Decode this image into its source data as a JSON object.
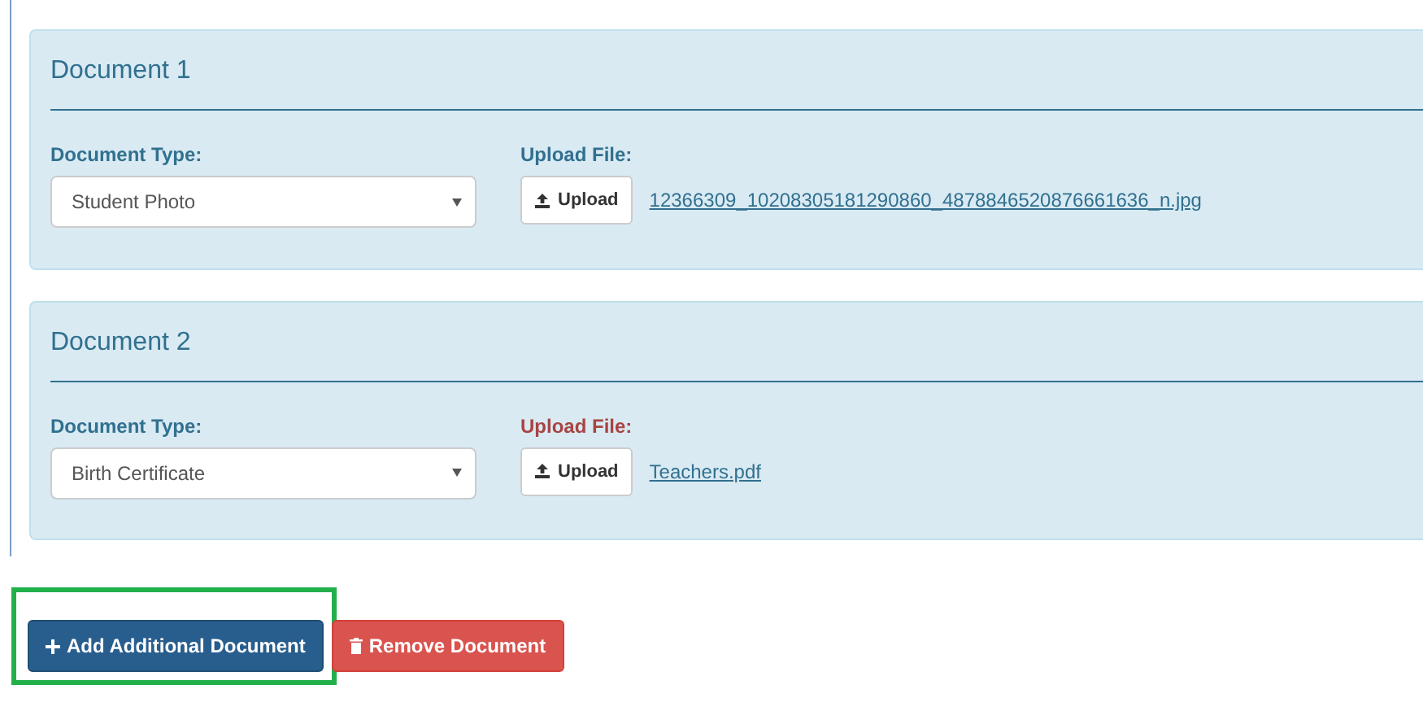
{
  "documents": [
    {
      "title": "Document 1",
      "type_label": "Document Type:",
      "type_value": "Student Photo",
      "upload_label": "Upload File:",
      "upload_invalid": false,
      "upload_button": "Upload",
      "file_name": "12366309_10208305181290860_4878846520876661636_n.jpg"
    },
    {
      "title": "Document 2",
      "type_label": "Document Type:",
      "type_value": "Birth Certificate",
      "upload_label": "Upload File:",
      "upload_invalid": true,
      "upload_button": "Upload",
      "file_name": "Teachers.pdf"
    }
  ],
  "actions": [
    {
      "kind": "add",
      "label": "Add Additional Document",
      "highlighted": true
    },
    {
      "kind": "remove",
      "label": "Remove Document",
      "highlighted": false
    }
  ]
}
